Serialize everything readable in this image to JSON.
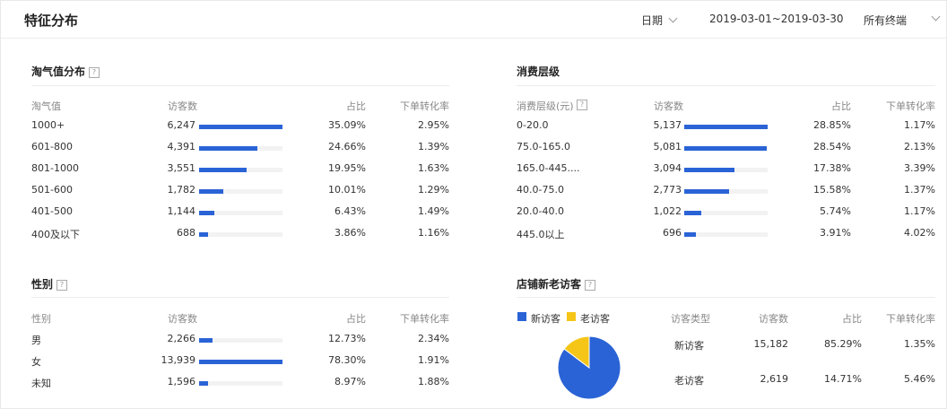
{
  "header": {
    "title": "特征分布",
    "date_label": "日期",
    "date_range": "2019-03-01~2019-03-30",
    "terminal_label": "所有终端"
  },
  "colors": {
    "bar": "#2a63d6",
    "new_visitor": "#2a63d6",
    "old_visitor": "#f5c518",
    "track": "#f2f2f2"
  },
  "taoqi": {
    "title": "淘气值分布",
    "headers": [
      "淘气值",
      "访客数",
      "占比",
      "下单转化率"
    ],
    "rows": [
      {
        "label": "1000+",
        "visitors": "6,247",
        "share": "35.09%",
        "conversion": "2.95%",
        "bar": 1.0
      },
      {
        "label": "601-800",
        "visitors": "4,391",
        "share": "24.66%",
        "conversion": "1.39%",
        "bar": 0.7
      },
      {
        "label": "801-1000",
        "visitors": "3,551",
        "share": "19.95%",
        "conversion": "1.63%",
        "bar": 0.57
      },
      {
        "label": "501-600",
        "visitors": "1,782",
        "share": "10.01%",
        "conversion": "1.29%",
        "bar": 0.29
      },
      {
        "label": "401-500",
        "visitors": "1,144",
        "share": "6.43%",
        "conversion": "1.49%",
        "bar": 0.18
      },
      {
        "label": "400及以下",
        "visitors": "688",
        "share": "3.86%",
        "conversion": "1.16%",
        "bar": 0.11
      }
    ]
  },
  "consumption": {
    "title": "消费层级",
    "headers": [
      "消费层级(元)",
      "访客数",
      "占比",
      "下单转化率"
    ],
    "rows": [
      {
        "label": "0-20.0",
        "visitors": "5,137",
        "share": "28.85%",
        "conversion": "1.17%",
        "bar": 1.0
      },
      {
        "label": "75.0-165.0",
        "visitors": "5,081",
        "share": "28.54%",
        "conversion": "2.13%",
        "bar": 0.99
      },
      {
        "label": "165.0-445....",
        "visitors": "3,094",
        "share": "17.38%",
        "conversion": "3.39%",
        "bar": 0.6
      },
      {
        "label": "40.0-75.0",
        "visitors": "2,773",
        "share": "15.58%",
        "conversion": "1.37%",
        "bar": 0.54
      },
      {
        "label": "20.0-40.0",
        "visitors": "1,022",
        "share": "5.74%",
        "conversion": "1.17%",
        "bar": 0.2
      },
      {
        "label": "445.0以上",
        "visitors": "696",
        "share": "3.91%",
        "conversion": "4.02%",
        "bar": 0.14
      }
    ]
  },
  "gender": {
    "title": "性别",
    "headers": [
      "性别",
      "访客数",
      "占比",
      "下单转化率"
    ],
    "rows": [
      {
        "label": "男",
        "visitors": "2,266",
        "share": "12.73%",
        "conversion": "2.34%",
        "bar": 0.16
      },
      {
        "label": "女",
        "visitors": "13,939",
        "share": "78.30%",
        "conversion": "1.91%",
        "bar": 1.0
      },
      {
        "label": "未知",
        "visitors": "1,596",
        "share": "8.97%",
        "conversion": "1.88%",
        "bar": 0.11
      }
    ]
  },
  "visitors": {
    "title": "店铺新老访客",
    "legend_new": "新访客",
    "legend_old": "老访客",
    "headers": [
      "访客类型",
      "访客数",
      "占比",
      "下单转化率"
    ],
    "rows": [
      {
        "label": "新访客",
        "visitors": "15,182",
        "share": "85.29%",
        "conversion": "1.35%"
      },
      {
        "label": "老访客",
        "visitors": "2,619",
        "share": "14.71%",
        "conversion": "5.46%"
      }
    ],
    "pie_new_fraction": 0.8529
  }
}
